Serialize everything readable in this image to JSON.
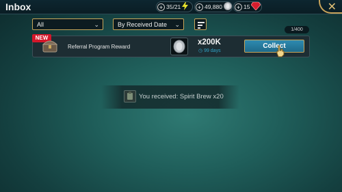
{
  "header": {
    "title": "Inbox",
    "energy": "35/21",
    "silver": "49,880",
    "gems": "15"
  },
  "filters": {
    "category": "All",
    "sort": "By Received Date"
  },
  "counter": "1/400",
  "mail": {
    "badge": "NEW",
    "title": "Referral Program Reward",
    "amount": "x200K",
    "expiry": "99 days",
    "collect_label": "Collect"
  },
  "toast": {
    "message": "You received: Spirit Brew x20"
  },
  "colors": {
    "accent_gold": "#c9a65a",
    "new_badge": "#d4172a",
    "collect_button": "#2e8ab0",
    "expiry_text": "#2fa5c9"
  }
}
